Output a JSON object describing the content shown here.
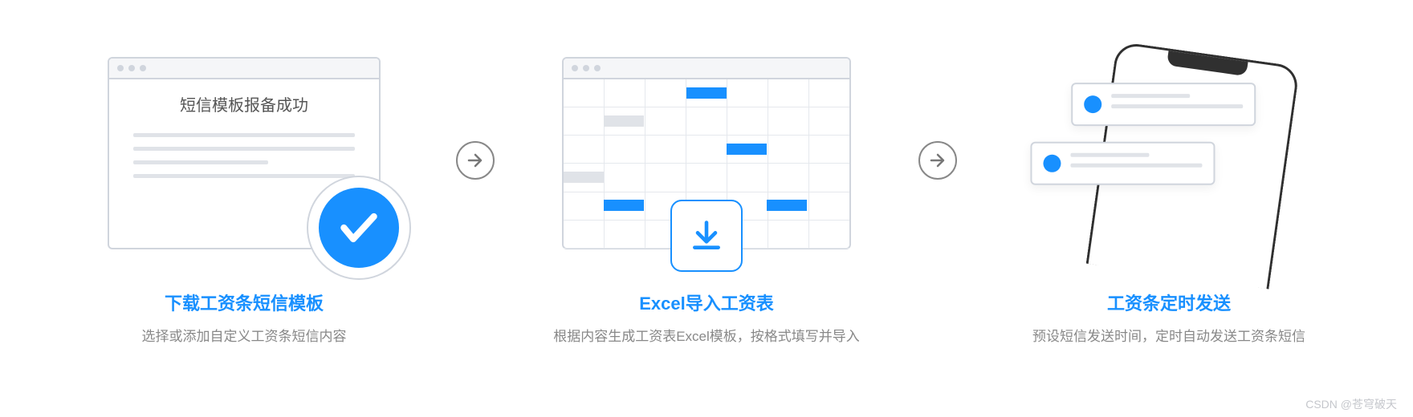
{
  "steps": [
    {
      "title": "下载工资条短信模板",
      "desc": "选择或添加自定义工资条短信内容",
      "browser_title": "短信模板报备成功"
    },
    {
      "title": "Excel导入工资表",
      "desc": "根据内容生成工资表Excel模板，按格式填写并导入"
    },
    {
      "title": "工资条定时发送",
      "desc": "预设短信发送时间，定时自动发送工资条短信"
    }
  ],
  "watermark": "CSDN @苍穹破天"
}
